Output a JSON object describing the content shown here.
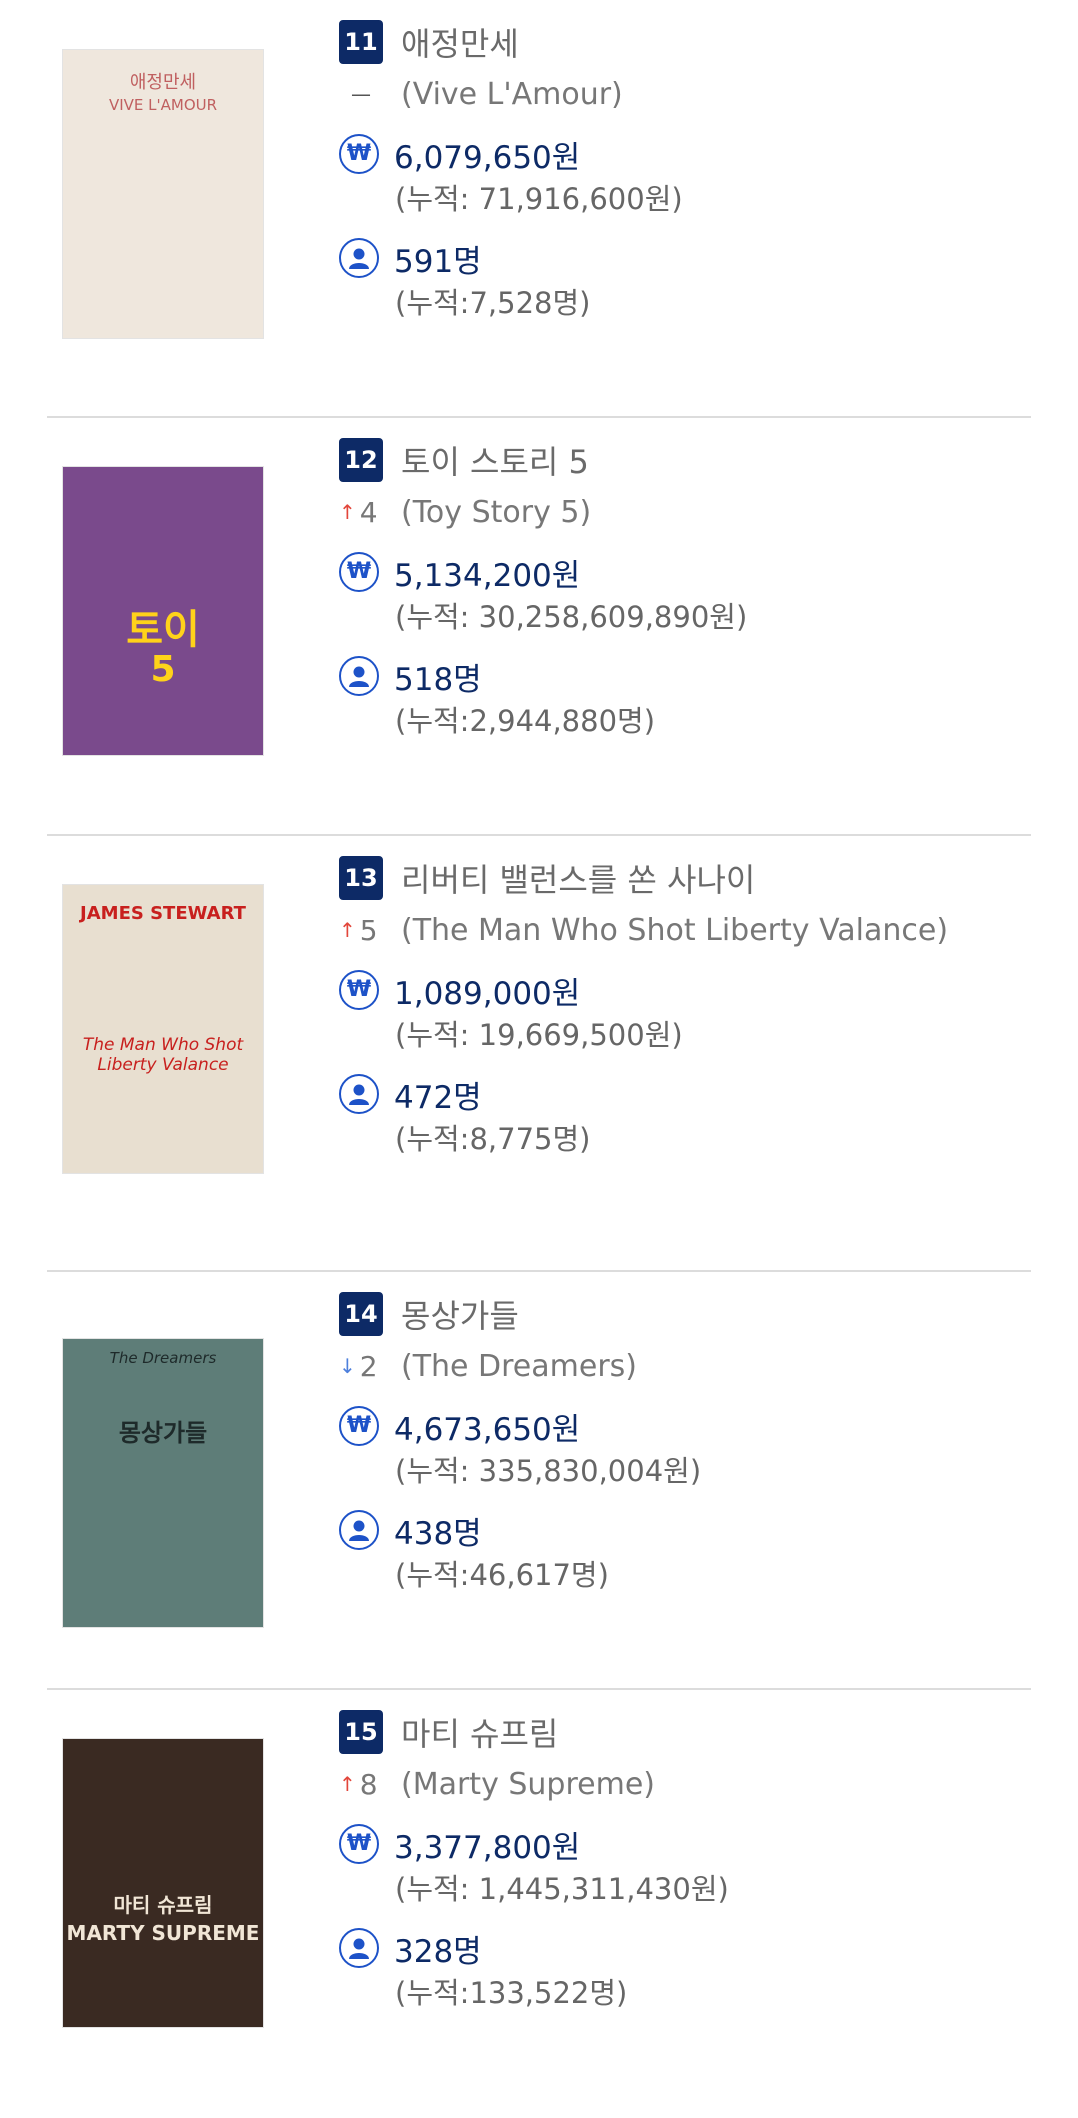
{
  "movies": [
    {
      "rank": "11",
      "change_dir": "same",
      "change_text": "",
      "title_ko": "애정만세",
      "title_en": "(Vive L'Amour)",
      "revenue": "6,079,650원",
      "revenue_cum": "(누적: 71,916,600원)",
      "audience": "591명",
      "audience_cum": "(누적:7,528명)",
      "poster": {
        "text1": "애정만세",
        "text2": "VIVE L'AMOUR",
        "bg": "#efe7dd",
        "fg": "#c06060"
      }
    },
    {
      "rank": "12",
      "change_dir": "up",
      "change_text": "4",
      "title_ko": "토이 스토리 5",
      "title_en": "(Toy Story 5)",
      "revenue": "5,134,200원",
      "revenue_cum": "(누적: 30,258,609,890원)",
      "audience": "518명",
      "audience_cum": "(누적:2,944,880명)",
      "poster": {
        "text1": "토이",
        "text2": "5",
        "bg": "#7a4a8c",
        "fg": "#ffd21a"
      }
    },
    {
      "rank": "13",
      "change_dir": "up",
      "change_text": "5",
      "title_ko": "리버티 밸런스를 쏜 사나이",
      "title_en": "(The Man Who Shot Liberty Valance)",
      "revenue": "1,089,000원",
      "revenue_cum": "(누적: 19,669,500원)",
      "audience": "472명",
      "audience_cum": "(누적:8,775명)",
      "poster": {
        "text1": "JAMES STEWART",
        "text2": "The Man Who Shot Liberty Valance",
        "bg": "#e8dfd0",
        "fg": "#c8201e"
      }
    },
    {
      "rank": "14",
      "change_dir": "down",
      "change_text": "2",
      "title_ko": "몽상가들",
      "title_en": "(The Dreamers)",
      "revenue": "4,673,650원",
      "revenue_cum": "(누적: 335,830,004원)",
      "audience": "438명",
      "audience_cum": "(누적:46,617명)",
      "poster": {
        "text1": "몽상가들",
        "text2": "The Dreamers",
        "bg": "#5e7d78",
        "fg": "#1e2a2a"
      }
    },
    {
      "rank": "15",
      "change_dir": "up",
      "change_text": "8",
      "title_ko": "마티 슈프림",
      "title_en": "(Marty Supreme)",
      "revenue": "3,377,800원",
      "revenue_cum": "(누적: 1,445,311,430원)",
      "audience": "328명",
      "audience_cum": "(누적:133,522명)",
      "poster": {
        "text1": "마티 슈프림",
        "text2": "MARTY SUPREME",
        "bg": "#3a2a22",
        "fg": "#f1e6d6"
      }
    }
  ],
  "icons": {
    "revenue": "won-icon",
    "audience": "person-icon",
    "up": "arrow-up-icon",
    "down": "arrow-down-icon",
    "same": "dash-icon"
  },
  "colors": {
    "rank_bg": "#0d2a66",
    "up": "#e2463b",
    "down": "#4d7fdc",
    "icon": "#1d52c8"
  }
}
